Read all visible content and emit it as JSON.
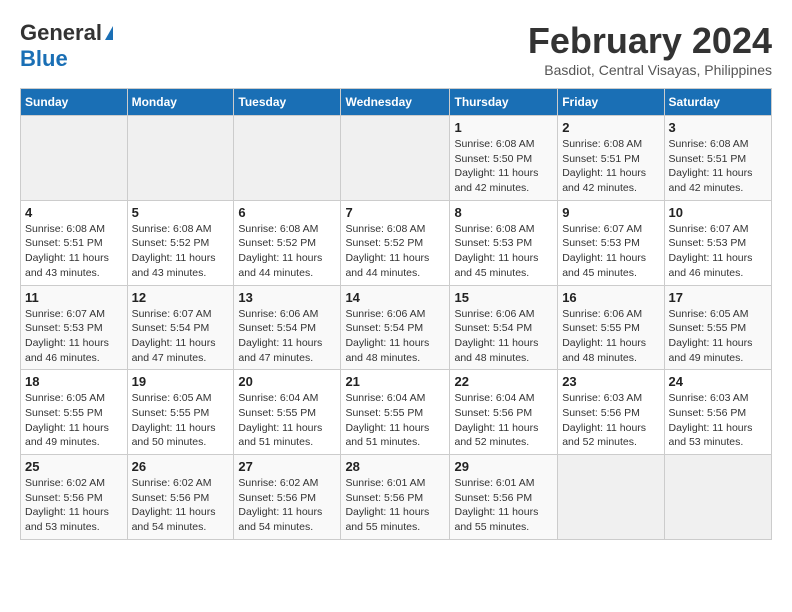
{
  "header": {
    "logo_general": "General",
    "logo_blue": "Blue",
    "month_title": "February 2024",
    "location": "Basdiot, Central Visayas, Philippines"
  },
  "days_of_week": [
    "Sunday",
    "Monday",
    "Tuesday",
    "Wednesday",
    "Thursday",
    "Friday",
    "Saturday"
  ],
  "weeks": [
    [
      {
        "day": "",
        "sunrise": "",
        "sunset": "",
        "daylight": "",
        "empty": true
      },
      {
        "day": "",
        "sunrise": "",
        "sunset": "",
        "daylight": "",
        "empty": true
      },
      {
        "day": "",
        "sunrise": "",
        "sunset": "",
        "daylight": "",
        "empty": true
      },
      {
        "day": "",
        "sunrise": "",
        "sunset": "",
        "daylight": "",
        "empty": true
      },
      {
        "day": "1",
        "sunrise": "6:08 AM",
        "sunset": "5:50 PM",
        "daylight": "11 hours and 42 minutes."
      },
      {
        "day": "2",
        "sunrise": "6:08 AM",
        "sunset": "5:51 PM",
        "daylight": "11 hours and 42 minutes."
      },
      {
        "day": "3",
        "sunrise": "6:08 AM",
        "sunset": "5:51 PM",
        "daylight": "11 hours and 42 minutes."
      }
    ],
    [
      {
        "day": "4",
        "sunrise": "6:08 AM",
        "sunset": "5:51 PM",
        "daylight": "11 hours and 43 minutes."
      },
      {
        "day": "5",
        "sunrise": "6:08 AM",
        "sunset": "5:52 PM",
        "daylight": "11 hours and 43 minutes."
      },
      {
        "day": "6",
        "sunrise": "6:08 AM",
        "sunset": "5:52 PM",
        "daylight": "11 hours and 44 minutes."
      },
      {
        "day": "7",
        "sunrise": "6:08 AM",
        "sunset": "5:52 PM",
        "daylight": "11 hours and 44 minutes."
      },
      {
        "day": "8",
        "sunrise": "6:08 AM",
        "sunset": "5:53 PM",
        "daylight": "11 hours and 45 minutes."
      },
      {
        "day": "9",
        "sunrise": "6:07 AM",
        "sunset": "5:53 PM",
        "daylight": "11 hours and 45 minutes."
      },
      {
        "day": "10",
        "sunrise": "6:07 AM",
        "sunset": "5:53 PM",
        "daylight": "11 hours and 46 minutes."
      }
    ],
    [
      {
        "day": "11",
        "sunrise": "6:07 AM",
        "sunset": "5:53 PM",
        "daylight": "11 hours and 46 minutes."
      },
      {
        "day": "12",
        "sunrise": "6:07 AM",
        "sunset": "5:54 PM",
        "daylight": "11 hours and 47 minutes."
      },
      {
        "day": "13",
        "sunrise": "6:06 AM",
        "sunset": "5:54 PM",
        "daylight": "11 hours and 47 minutes."
      },
      {
        "day": "14",
        "sunrise": "6:06 AM",
        "sunset": "5:54 PM",
        "daylight": "11 hours and 48 minutes."
      },
      {
        "day": "15",
        "sunrise": "6:06 AM",
        "sunset": "5:54 PM",
        "daylight": "11 hours and 48 minutes."
      },
      {
        "day": "16",
        "sunrise": "6:06 AM",
        "sunset": "5:55 PM",
        "daylight": "11 hours and 48 minutes."
      },
      {
        "day": "17",
        "sunrise": "6:05 AM",
        "sunset": "5:55 PM",
        "daylight": "11 hours and 49 minutes."
      }
    ],
    [
      {
        "day": "18",
        "sunrise": "6:05 AM",
        "sunset": "5:55 PM",
        "daylight": "11 hours and 49 minutes."
      },
      {
        "day": "19",
        "sunrise": "6:05 AM",
        "sunset": "5:55 PM",
        "daylight": "11 hours and 50 minutes."
      },
      {
        "day": "20",
        "sunrise": "6:04 AM",
        "sunset": "5:55 PM",
        "daylight": "11 hours and 51 minutes."
      },
      {
        "day": "21",
        "sunrise": "6:04 AM",
        "sunset": "5:55 PM",
        "daylight": "11 hours and 51 minutes."
      },
      {
        "day": "22",
        "sunrise": "6:04 AM",
        "sunset": "5:56 PM",
        "daylight": "11 hours and 52 minutes."
      },
      {
        "day": "23",
        "sunrise": "6:03 AM",
        "sunset": "5:56 PM",
        "daylight": "11 hours and 52 minutes."
      },
      {
        "day": "24",
        "sunrise": "6:03 AM",
        "sunset": "5:56 PM",
        "daylight": "11 hours and 53 minutes."
      }
    ],
    [
      {
        "day": "25",
        "sunrise": "6:02 AM",
        "sunset": "5:56 PM",
        "daylight": "11 hours and 53 minutes."
      },
      {
        "day": "26",
        "sunrise": "6:02 AM",
        "sunset": "5:56 PM",
        "daylight": "11 hours and 54 minutes."
      },
      {
        "day": "27",
        "sunrise": "6:02 AM",
        "sunset": "5:56 PM",
        "daylight": "11 hours and 54 minutes."
      },
      {
        "day": "28",
        "sunrise": "6:01 AM",
        "sunset": "5:56 PM",
        "daylight": "11 hours and 55 minutes."
      },
      {
        "day": "29",
        "sunrise": "6:01 AM",
        "sunset": "5:56 PM",
        "daylight": "11 hours and 55 minutes."
      },
      {
        "day": "",
        "sunrise": "",
        "sunset": "",
        "daylight": "",
        "empty": true
      },
      {
        "day": "",
        "sunrise": "",
        "sunset": "",
        "daylight": "",
        "empty": true
      }
    ]
  ],
  "labels": {
    "sunrise_prefix": "Sunrise: ",
    "sunset_prefix": "Sunset: ",
    "daylight_prefix": "Daylight: "
  }
}
